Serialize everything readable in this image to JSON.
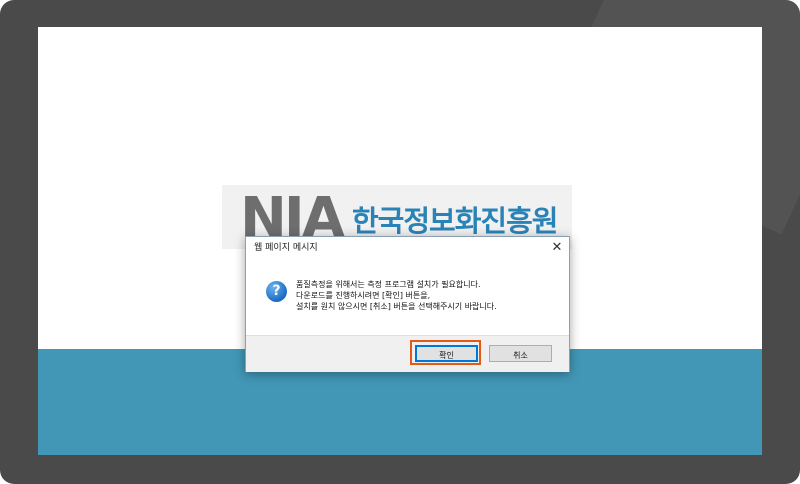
{
  "logo": {
    "mark": "NIA",
    "name": "한국정보화진흥원"
  },
  "dialog": {
    "title": "웹 페이지 메시지",
    "close_glyph": "✕",
    "icon": "question-icon",
    "icon_glyph": "?",
    "message_lines": [
      "품질측정을 위해서는 측정 프로그램 설치가 필요합니다.",
      "다운로드를 진행하시려면 [확인] 버튼을,",
      "설치를 원치 않으시면 [취소] 버튼을 선택해주시기 바랍니다."
    ],
    "ok_label": "확인",
    "cancel_label": "취소"
  },
  "colors": {
    "frame": "#4a4a4a",
    "band": "#4297b6",
    "logo_text": "#2a83b7",
    "highlight": "#e25a16"
  }
}
